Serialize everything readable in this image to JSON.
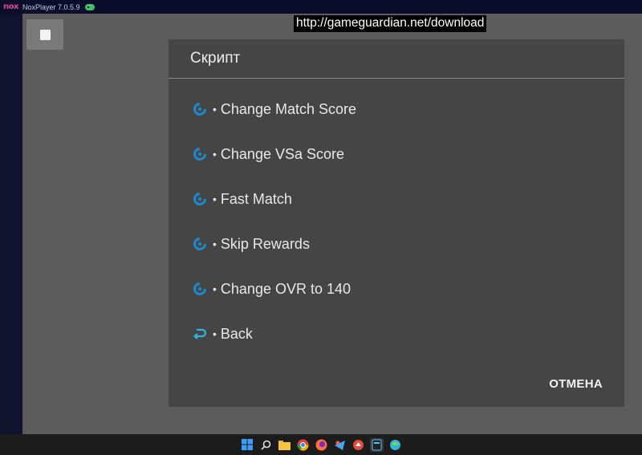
{
  "window": {
    "title": "NoxPlayer 7.0.5.9",
    "logo_text": "nox"
  },
  "url_banner": "http://gameguardian.net/download",
  "dialog": {
    "title": "Скрипт",
    "items": [
      {
        "label": "Change Match Score",
        "icon": "gameguardian-icon"
      },
      {
        "label": "Change VSa Score",
        "icon": "gameguardian-icon"
      },
      {
        "label": "Fast Match",
        "icon": "gameguardian-icon"
      },
      {
        "label": "Skip Rewards",
        "icon": "gameguardian-icon"
      },
      {
        "label": "Change OVR to 140",
        "icon": "gameguardian-icon"
      },
      {
        "label": "Back",
        "icon": "back-arrow-icon"
      }
    ],
    "bullet": "•",
    "cancel_label": "ОТМЕНА"
  },
  "colors": {
    "dialog_bg": "#454545",
    "screen_bg": "#5c5c5c",
    "accent": "#1e88c8"
  },
  "taskbar": {
    "icons": [
      "windows-start-icon",
      "search-icon",
      "file-explorer-icon",
      "chrome-icon",
      "firefox-icon",
      "app-icon",
      "app-icon",
      "nox-icon",
      "browser-icon"
    ]
  }
}
